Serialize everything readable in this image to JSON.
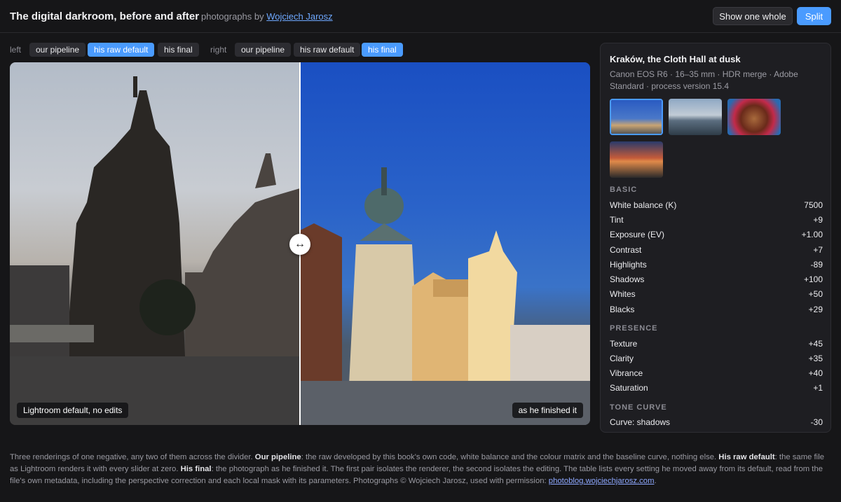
{
  "header": {
    "title": "The digital darkroom, before and after",
    "byline_prefix": "photographs by",
    "byline_link": "Wojciech Jarosz",
    "show_one_label": "Show one whole",
    "split_label": "Split"
  },
  "chooser": {
    "left_label": "left",
    "right_label": "right",
    "left_options": [
      "our pipeline",
      "his raw default",
      "his final"
    ],
    "left_selected": "his raw default",
    "right_options": [
      "our pipeline",
      "his raw default",
      "his final"
    ],
    "right_selected": "his final"
  },
  "compare": {
    "left_caption": "Lightroom default, no edits",
    "right_caption": "as he finished it",
    "divider_position": 0.5
  },
  "panel": {
    "title": "Kraków, the Cloth Hall at dusk",
    "meta": "Canon EOS R6 · 16–35 mm · HDR merge · Adobe Standard · process version 15.4",
    "basic_heading": "BASIC",
    "basic": [
      {
        "k": "White balance (K)",
        "v": "7500"
      },
      {
        "k": "Tint",
        "v": "+9"
      },
      {
        "k": "Exposure (EV)",
        "v": "+1.00"
      },
      {
        "k": "Contrast",
        "v": "+7"
      },
      {
        "k": "Highlights",
        "v": "-89"
      },
      {
        "k": "Shadows",
        "v": "+100"
      },
      {
        "k": "Whites",
        "v": "+50"
      },
      {
        "k": "Blacks",
        "v": "+29"
      }
    ],
    "presence_heading": "PRESENCE",
    "presence": [
      {
        "k": "Texture",
        "v": "+45"
      },
      {
        "k": "Clarity",
        "v": "+35"
      },
      {
        "k": "Vibrance",
        "v": "+40"
      },
      {
        "k": "Saturation",
        "v": "+1"
      }
    ],
    "tone_heading": "TONE CURVE",
    "tone": [
      {
        "k": "Curve: shadows",
        "v": "-30"
      }
    ]
  },
  "footer": {
    "p1": "Three renderings of one negative, any two of them across the divider. ",
    "b1": "Our pipeline",
    "p2": ": the raw developed by this book's own code, white balance and the colour matrix and the baseline curve, nothing else. ",
    "b2": "His raw default",
    "p3": ": the same file as Lightroom renders it with every slider at zero. ",
    "b3": "His final",
    "p4": ": the photograph as he finished it. The first pair isolates the renderer, the second isolates the editing. The table lists every setting he moved away from its default, read from the file's own metadata, including the perspective correction and each local mask with its parameters. Photographs © Wojciech Jarosz, used with permission: ",
    "link": "photoblog.wojciechjarosz.com",
    "p5": "."
  }
}
